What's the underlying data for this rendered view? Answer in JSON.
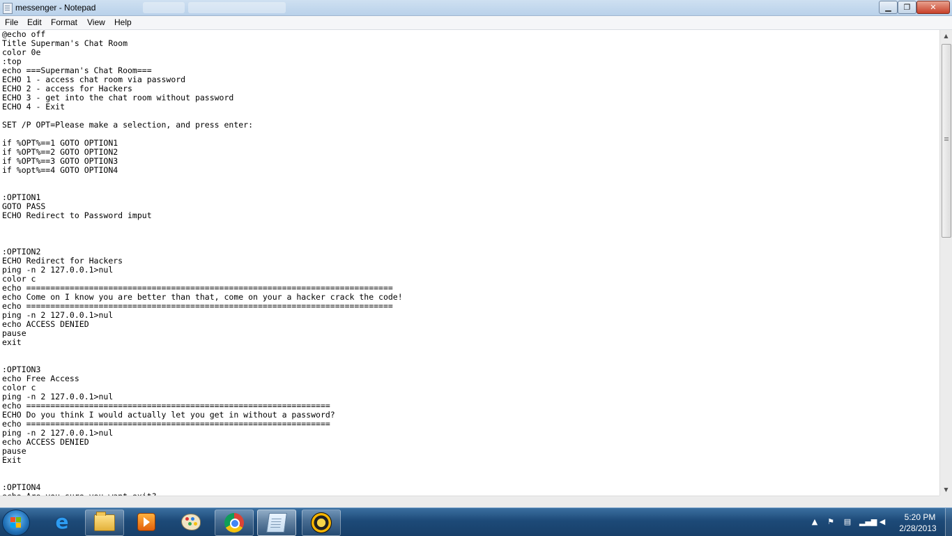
{
  "window": {
    "title": "messenger - Notepad"
  },
  "menu": {
    "items": [
      "File",
      "Edit",
      "Format",
      "View",
      "Help"
    ]
  },
  "editor": {
    "lines": [
      "@echo off",
      "Title Superman's Chat Room",
      "color 0e",
      ":top",
      "echo ===Superman's Chat Room===",
      "ECHO 1 - access chat room via password",
      "ECHO 2 - access for Hackers",
      "ECHO 3 - get into the chat room without password",
      "ECHO 4 - Exit",
      "",
      "SET /P OPT=Please make a selection, and press enter:",
      "",
      "if %OPT%==1 GOTO OPTION1",
      "if %OPT%==2 GOTO OPTION2",
      "if %OPT%==3 GOTO OPTION3",
      "if %opt%==4 GOTO OPTION4",
      "",
      "",
      ":OPTION1",
      "GOTO PASS",
      "ECHO Redirect to Password imput",
      "",
      "",
      "",
      ":OPTION2",
      "ECHO Redirect for Hackers",
      "ping -n 2 127.0.0.1>nul",
      "color c",
      "echo ============================================================================",
      "echo Come on I know you are better than that, come on your a hacker crack the code!",
      "echo ============================================================================",
      "ping -n 2 127.0.0.1>nul",
      "echo ACCESS DENIED",
      "pause",
      "exit",
      "",
      "",
      ":OPTION3",
      "echo Free Access",
      "color c",
      "ping -n 2 127.0.0.1>nul",
      "echo ===============================================================",
      "ECHO Do you think I would actually let you get in without a password?",
      "echo ===============================================================",
      "ping -n 2 127.0.0.1>nul",
      "echo ACCESS DENIED",
      "pause",
      "Exit",
      "",
      "",
      ":OPTION4",
      "echo Are you sure you want exit?"
    ]
  },
  "scrollbar": {
    "position": 0.0
  },
  "taskbar": {
    "apps": [
      {
        "name": "internet-explorer",
        "icon": "ie-icon",
        "state": "pinned"
      },
      {
        "name": "windows-explorer",
        "icon": "folder-icon",
        "state": "running"
      },
      {
        "name": "media-player",
        "icon": "media-player-icon",
        "state": "pinned"
      },
      {
        "name": "paint",
        "icon": "paint-icon",
        "state": "pinned"
      },
      {
        "name": "chrome",
        "icon": "chrome-icon",
        "state": "running"
      },
      {
        "name": "notepad",
        "icon": "notepad-icon",
        "state": "active"
      },
      {
        "name": "app",
        "icon": "sphere-app-icon",
        "state": "running"
      }
    ],
    "clock": {
      "time": "5:20 PM",
      "date": "2/28/2013"
    }
  },
  "colors": {
    "taskbar": "#1d4a78",
    "titlebar": "#c1d6ec",
    "close_button": "#c8412a"
  }
}
